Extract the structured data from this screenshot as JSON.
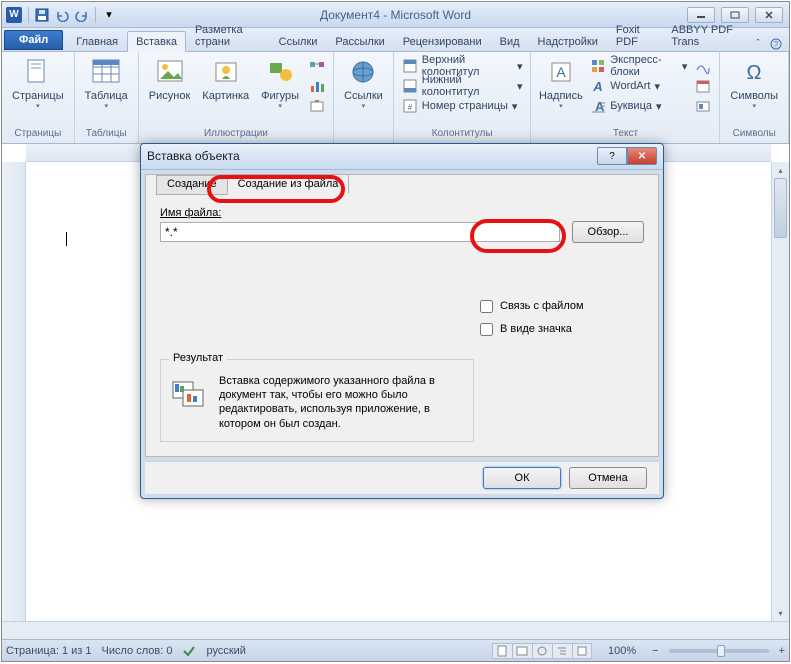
{
  "title": "Документ4  -  Microsoft Word",
  "tabs": {
    "file": "Файл",
    "list": [
      "Главная",
      "Вставка",
      "Разметка страни",
      "Ссылки",
      "Рассылки",
      "Рецензировани",
      "Вид",
      "Надстройки",
      "Foxit PDF",
      "ABBYY PDF Trans"
    ],
    "active_index": 1
  },
  "ribbon": {
    "pages": {
      "label": "Страницы",
      "btn": "Страницы"
    },
    "tables": {
      "label": "Таблицы",
      "btn": "Таблица"
    },
    "illustrations": {
      "label": "Иллюстрации",
      "btns": [
        "Рисунок",
        "Картинка",
        "Фигуры"
      ]
    },
    "links": {
      "label": "",
      "btn": "Ссылки"
    },
    "headers": {
      "label": "Колонтитулы",
      "items": [
        "Верхний колонтитул",
        "Нижний колонтитул",
        "Номер страницы"
      ]
    },
    "text": {
      "label": "Текст",
      "btn": "Надпись",
      "items": [
        "Экспресс-блоки",
        "WordArt",
        "Буквица"
      ]
    },
    "symbols": {
      "label": "Символы",
      "btn": "Символы"
    }
  },
  "dialog": {
    "title": "Вставка объекта",
    "tabs": [
      "Создание",
      "Создание из файла"
    ],
    "filename_label": "Имя файла:",
    "filename_value": "*.*",
    "browse": "Обзор...",
    "chk_link": "Связь с файлом",
    "chk_icon": "В виде значка",
    "result_legend": "Результат",
    "result_text": "Вставка содержимого указанного файла в документ так, чтобы его можно было редактировать, используя приложение, в котором он был создан.",
    "ok": "ОК",
    "cancel": "Отмена"
  },
  "status": {
    "page": "Страница: 1 из 1",
    "words": "Число слов: 0",
    "lang": "русский",
    "zoom": "100%"
  }
}
